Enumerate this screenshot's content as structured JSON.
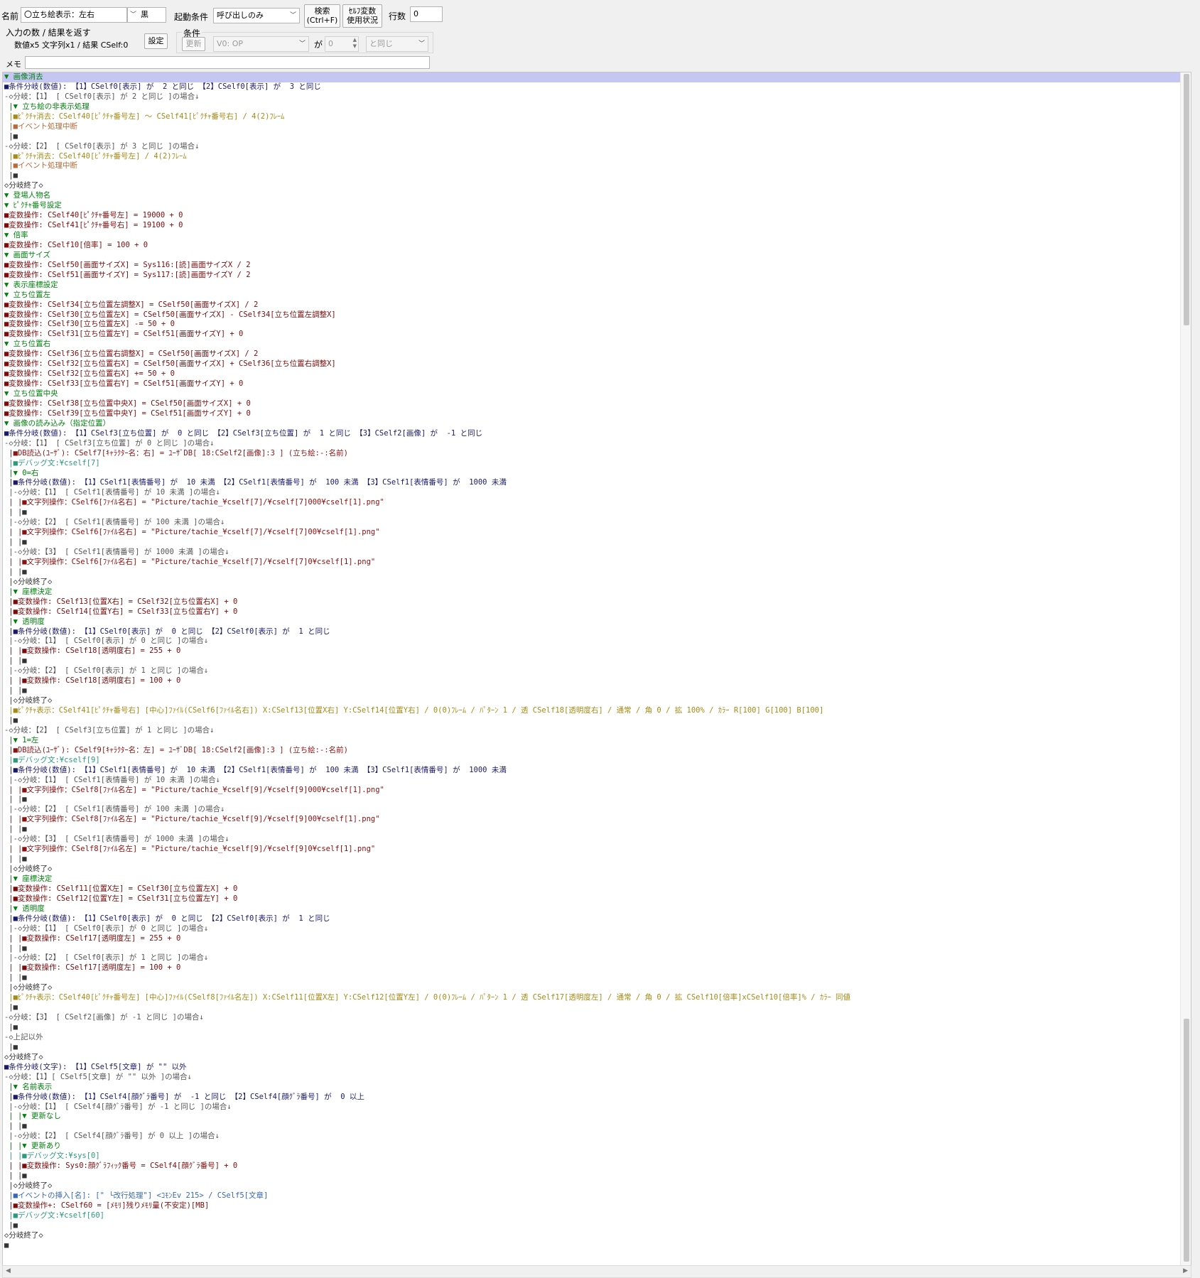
{
  "header": {
    "name_label": "名前",
    "name_value": "〇立ち絵表示：左右",
    "color_value": "黒",
    "trigger_label": "起動条件",
    "trigger_value": "呼び出しのみ",
    "search_label_1": "検索",
    "search_label_2": "(Ctrl+F)",
    "selfvar_label_1": "ｾﾙﾌ変数",
    "selfvar_label_2": "使用状況",
    "lines_label": "行数",
    "lines_value": "0",
    "io_label": "入力の数 / 結果を返す",
    "io_value": "数値x5 文字列x1 / 結果 CSelf:0",
    "setting_button": "設定",
    "cond_label": "条件",
    "update_button": "更新",
    "cond_var": "V0: OP",
    "ga": "が",
    "cond_num": "0",
    "cond_op": "と同じ",
    "memo_label": "メモ",
    "memo_value": ""
  },
  "code": {
    "lines": [
      {
        "t": "▼ 画像消去",
        "c": "c-header",
        "s": true
      },
      {
        "t": "■条件分岐(数値): 【1】CSelf0[表示] が  2 と同じ 【2】CSelf0[表示] が  3 と同じ",
        "c": "c-cond"
      },
      {
        "t": "-◇分岐：【1】 [ CSelf0[表示] が 2 と同じ ]の場合↓",
        "c": "c-branch"
      },
      {
        "t": " |▼ 立ち絵の非表示処理",
        "c": "c-sub"
      },
      {
        "t": " |■ﾋﾟｸﾁｬ消去：CSelf40[ﾋﾟｸﾁｬ番号左] ～ CSelf41[ﾋﾟｸﾁｬ番号右] / 4(2)ﾌﾚｰﾑ",
        "c": "c-pic"
      },
      {
        "t": " |■イベント処理中断",
        "c": "c-ev"
      },
      {
        "t": " |■",
        "c": "c-blank"
      },
      {
        "t": "-◇分岐：【2】 [ CSelf0[表示] が 3 と同じ ]の場合↓",
        "c": "c-branch"
      },
      {
        "t": " |■ﾋﾟｸﾁｬ消去：CSelf40[ﾋﾟｸﾁｬ番号左] / 4(2)ﾌﾚｰﾑ",
        "c": "c-pic"
      },
      {
        "t": " |■イベント処理中断",
        "c": "c-ev"
      },
      {
        "t": " |■",
        "c": "c-blank"
      },
      {
        "t": "◇分岐終了◇",
        "c": "c-end"
      },
      {
        "t": "▼ 登場人物名",
        "c": "c-header"
      },
      {
        "t": "▼ ﾋﾟｸﾁｬ番号設定",
        "c": "c-header"
      },
      {
        "t": "■変数操作: CSelf40[ﾋﾟｸﾁｬ番号左] = 19000 + 0",
        "c": "c-var"
      },
      {
        "t": "■変数操作: CSelf41[ﾋﾟｸﾁｬ番号右] = 19100 + 0",
        "c": "c-var"
      },
      {
        "t": "▼ 倍率",
        "c": "c-header"
      },
      {
        "t": "■変数操作: CSelf10[倍率] = 100 + 0",
        "c": "c-var"
      },
      {
        "t": "▼ 画面サイズ",
        "c": "c-header"
      },
      {
        "t": "■変数操作: CSelf50[画面サイズX] = Sys116:[読]画面サイズX / 2",
        "c": "c-var"
      },
      {
        "t": "■変数操作: CSelf51[画面サイズY] = Sys117:[読]画面サイズY / 2",
        "c": "c-var"
      },
      {
        "t": "▼ 表示座標設定",
        "c": "c-header"
      },
      {
        "t": "▼ 立ち位置左",
        "c": "c-header"
      },
      {
        "t": "■変数操作: CSelf34[立ち位置左調整X] = CSelf50[画面サイズX] / 2",
        "c": "c-var"
      },
      {
        "t": "■変数操作: CSelf30[立ち位置左X] = CSelf50[画面サイズX] - CSelf34[立ち位置左調整X]",
        "c": "c-var"
      },
      {
        "t": "■変数操作: CSelf30[立ち位置左X] -= 50 + 0",
        "c": "c-var"
      },
      {
        "t": "■変数操作: CSelf31[立ち位置左Y] = CSelf51[画面サイズY] + 0",
        "c": "c-var"
      },
      {
        "t": "▼ 立ち位置右",
        "c": "c-header"
      },
      {
        "t": "■変数操作: CSelf36[立ち位置右調整X] = CSelf50[画面サイズX] / 2",
        "c": "c-var"
      },
      {
        "t": "■変数操作: CSelf32[立ち位置右X] = CSelf50[画面サイズX] + CSelf36[立ち位置右調整X]",
        "c": "c-var"
      },
      {
        "t": "■変数操作: CSelf32[立ち位置右X] += 50 + 0",
        "c": "c-var"
      },
      {
        "t": "■変数操作: CSelf33[立ち位置右Y] = CSelf51[画面サイズY] + 0",
        "c": "c-var"
      },
      {
        "t": "▼ 立ち位置中央",
        "c": "c-header"
      },
      {
        "t": "■変数操作: CSelf38[立ち位置中央X] = CSelf50[画面サイズX] + 0",
        "c": "c-var"
      },
      {
        "t": "■変数操作: CSelf39[立ち位置中央Y] = CSelf51[画面サイズY] + 0",
        "c": "c-var"
      },
      {
        "t": "▼ 画像の読み込み（指定位置）",
        "c": "c-header"
      },
      {
        "t": "■条件分岐(数値): 【1】CSelf3[立ち位置] が  0 と同じ 【2】CSelf3[立ち位置] が  1 と同じ 【3】CSelf2[画像] が  -1 と同じ",
        "c": "c-cond"
      },
      {
        "t": "-◇分岐：【1】 [ CSelf3[立ち位置] が 0 と同じ ]の場合↓",
        "c": "c-branch"
      },
      {
        "t": " |■DB読込(ﾕｰｻﾞ): CSelf7[ｷｬﾗｸﾀｰ名：右] = ﾕｰｻﾞDB[ 18:CSelf2[画像]:3 ] (立ち絵:-:名前)",
        "c": "c-db"
      },
      {
        "t": " |■デバッグ文:¥cself[7]",
        "c": "c-debug"
      },
      {
        "t": " |▼ 0=右",
        "c": "c-sub"
      },
      {
        "t": " |■条件分岐(数値): 【1】CSelf1[表情番号] が  10 未満 【2】CSelf1[表情番号] が  100 未満 【3】CSelf1[表情番号] が  1000 未満",
        "c": "c-cond"
      },
      {
        "t": " |-◇分岐：【1】 [ CSelf1[表情番号] が 10 未満 ]の場合↓",
        "c": "c-branch"
      },
      {
        "t": " | |■文字列操作：CSelf6[ﾌｧｲﾙ名右] = \"Picture/tachie_¥cself[7]/¥cself[7]000¥cself[1].png\"",
        "c": "c-str"
      },
      {
        "t": " | |■",
        "c": "c-blank"
      },
      {
        "t": " |-◇分岐：【2】 [ CSelf1[表情番号] が 100 未満 ]の場合↓",
        "c": "c-branch"
      },
      {
        "t": " | |■文字列操作：CSelf6[ﾌｧｲﾙ名右] = \"Picture/tachie_¥cself[7]/¥cself[7]00¥cself[1].png\"",
        "c": "c-str"
      },
      {
        "t": " | |■",
        "c": "c-blank"
      },
      {
        "t": " |-◇分岐：【3】 [ CSelf1[表情番号] が 1000 未満 ]の場合↓",
        "c": "c-branch"
      },
      {
        "t": " | |■文字列操作：CSelf6[ﾌｧｲﾙ名右] = \"Picture/tachie_¥cself[7]/¥cself[7]0¥cself[1].png\"",
        "c": "c-str"
      },
      {
        "t": " | |■",
        "c": "c-blank"
      },
      {
        "t": " |◇分岐終了◇",
        "c": "c-end"
      },
      {
        "t": " |▼ 座標決定",
        "c": "c-sub"
      },
      {
        "t": " |■変数操作: CSelf13[位置X右] = CSelf32[立ち位置右X] + 0",
        "c": "c-var"
      },
      {
        "t": " |■変数操作: CSelf14[位置Y右] = CSelf33[立ち位置右Y] + 0",
        "c": "c-var"
      },
      {
        "t": " |▼ 透明度",
        "c": "c-sub"
      },
      {
        "t": " |■条件分岐(数値): 【1】CSelf0[表示] が  0 と同じ 【2】CSelf0[表示] が  1 と同じ",
        "c": "c-cond"
      },
      {
        "t": " |-◇分岐：【1】 [ CSelf0[表示] が 0 と同じ ]の場合↓",
        "c": "c-branch"
      },
      {
        "t": " | |■変数操作: CSelf18[透明度右] = 255 + 0",
        "c": "c-var"
      },
      {
        "t": " | |■",
        "c": "c-blank"
      },
      {
        "t": " |-◇分岐：【2】 [ CSelf0[表示] が 1 と同じ ]の場合↓",
        "c": "c-branch"
      },
      {
        "t": " | |■変数操作: CSelf18[透明度右] = 100 + 0",
        "c": "c-var"
      },
      {
        "t": " | |■",
        "c": "c-blank"
      },
      {
        "t": " |◇分岐終了◇",
        "c": "c-end"
      },
      {
        "t": " |■ﾋﾟｸﾁｬ表示：CSelf41[ﾋﾟｸﾁｬ番号右] [中心]ﾌｧｲﾙ(CSelf6[ﾌｧｲﾙ名右]) X:CSelf13[位置X右] Y:CSelf14[位置Y右] / 0(0)ﾌﾚｰﾑ / ﾊﾟﾀｰﾝ 1 / 透 CSelf18[透明度右] / 通常 / 角 0 / 拡 100% / ｶﾗｰ R[100] G[100] B[100]",
        "c": "c-pic"
      },
      {
        "t": " |■",
        "c": "c-blank"
      },
      {
        "t": "-◇分岐：【2】 [ CSelf3[立ち位置] が 1 と同じ ]の場合↓",
        "c": "c-branch"
      },
      {
        "t": " |▼ 1=左",
        "c": "c-sub"
      },
      {
        "t": " |■DB読込(ﾕｰｻﾞ): CSelf9[ｷｬﾗｸﾀｰ名：左] = ﾕｰｻﾞDB[ 18:CSelf2[画像]:3 ] (立ち絵:-:名前)",
        "c": "c-db"
      },
      {
        "t": " |■デバッグ文:¥cself[9]",
        "c": "c-debug"
      },
      {
        "t": " |■条件分岐(数値): 【1】CSelf1[表情番号] が  10 未満 【2】CSelf1[表情番号] が  100 未満 【3】CSelf1[表情番号] が  1000 未満",
        "c": "c-cond"
      },
      {
        "t": " |-◇分岐：【1】 [ CSelf1[表情番号] が 10 未満 ]の場合↓",
        "c": "c-branch"
      },
      {
        "t": " | |■文字列操作：CSelf8[ﾌｧｲﾙ名左] = \"Picture/tachie_¥cself[9]/¥cself[9]000¥cself[1].png\"",
        "c": "c-str"
      },
      {
        "t": " | |■",
        "c": "c-blank"
      },
      {
        "t": " |-◇分岐：【2】 [ CSelf1[表情番号] が 100 未満 ]の場合↓",
        "c": "c-branch"
      },
      {
        "t": " | |■文字列操作：CSelf8[ﾌｧｲﾙ名左] = \"Picture/tachie_¥cself[9]/¥cself[9]00¥cself[1].png\"",
        "c": "c-str"
      },
      {
        "t": " | |■",
        "c": "c-blank"
      },
      {
        "t": " |-◇分岐：【3】 [ CSelf1[表情番号] が 1000 未満 ]の場合↓",
        "c": "c-branch"
      },
      {
        "t": " | |■文字列操作：CSelf8[ﾌｧｲﾙ名左] = \"Picture/tachie_¥cself[9]/¥cself[9]0¥cself[1].png\"",
        "c": "c-str"
      },
      {
        "t": " | |■",
        "c": "c-blank"
      },
      {
        "t": " |◇分岐終了◇",
        "c": "c-end"
      },
      {
        "t": " |▼ 座標決定",
        "c": "c-sub"
      },
      {
        "t": " |■変数操作: CSelf11[位置X左] = CSelf30[立ち位置左X] + 0",
        "c": "c-var"
      },
      {
        "t": " |■変数操作: CSelf12[位置Y左] = CSelf31[立ち位置左Y] + 0",
        "c": "c-var"
      },
      {
        "t": " |▼ 透明度",
        "c": "c-sub"
      },
      {
        "t": " |■条件分岐(数値): 【1】CSelf0[表示] が  0 と同じ 【2】CSelf0[表示] が  1 と同じ",
        "c": "c-cond"
      },
      {
        "t": " |-◇分岐：【1】 [ CSelf0[表示] が 0 と同じ ]の場合↓",
        "c": "c-branch"
      },
      {
        "t": " | |■変数操作: CSelf17[透明度左] = 255 + 0",
        "c": "c-var"
      },
      {
        "t": " | |■",
        "c": "c-blank"
      },
      {
        "t": " |-◇分岐：【2】 [ CSelf0[表示] が 1 と同じ ]の場合↓",
        "c": "c-branch"
      },
      {
        "t": " | |■変数操作: CSelf17[透明度左] = 100 + 0",
        "c": "c-var"
      },
      {
        "t": " | |■",
        "c": "c-blank"
      },
      {
        "t": " |◇分岐終了◇",
        "c": "c-end"
      },
      {
        "t": " |■ﾋﾟｸﾁｬ表示：CSelf40[ﾋﾟｸﾁｬ番号左] [中心]ﾌｧｲﾙ(CSelf8[ﾌｧｲﾙ名左]) X:CSelf11[位置X左] Y:CSelf12[位置Y左] / 0(0)ﾌﾚｰﾑ / ﾊﾟﾀｰﾝ 1 / 透 CSelf17[透明度左] / 通常 / 角 0 / 拡 CSelf10[倍率]xCSelf10[倍率]% / ｶﾗｰ 同値",
        "c": "c-pic"
      },
      {
        "t": " |■",
        "c": "c-blank"
      },
      {
        "t": "-◇分岐：【3】 [ CSelf2[画像] が -1 と同じ ]の場合↓",
        "c": "c-branch"
      },
      {
        "t": " |■",
        "c": "c-blank"
      },
      {
        "t": "-◇上記以外",
        "c": "c-branch"
      },
      {
        "t": " |■",
        "c": "c-blank"
      },
      {
        "t": "◇分岐終了◇",
        "c": "c-end"
      },
      {
        "t": "■条件分岐(文字): 【1】CSelf5[文章] が \"\" 以外",
        "c": "c-cond"
      },
      {
        "t": "-◇分岐：【1】[ CSelf5[文章] が \"\" 以外 ]の場合↓",
        "c": "c-branch"
      },
      {
        "t": " |▼ 名前表示",
        "c": "c-sub"
      },
      {
        "t": " |■条件分岐(数値): 【1】CSelf4[顔ｸﾞﾗ番号] が  -1 と同じ 【2】CSelf4[顔ｸﾞﾗ番号] が  0 以上",
        "c": "c-cond"
      },
      {
        "t": " |-◇分岐：【1】 [ CSelf4[顔ｸﾞﾗ番号] が -1 と同じ ]の場合↓",
        "c": "c-branch"
      },
      {
        "t": " | |▼ 更新なし",
        "c": "c-sub"
      },
      {
        "t": " | |■",
        "c": "c-blank"
      },
      {
        "t": " |-◇分岐：【2】 [ CSelf4[顔ｸﾞﾗ番号] が 0 以上 ]の場合↓",
        "c": "c-branch"
      },
      {
        "t": " | |▼ 更新あり",
        "c": "c-sub"
      },
      {
        "t": " | |■デバッグ文:¥sys[0]",
        "c": "c-debug"
      },
      {
        "t": " | |■変数操作: Sys0:顔ｸﾞﾗﾌｨｯｸ番号 = CSelf4[顔ｸﾞﾗ番号] + 0",
        "c": "c-var"
      },
      {
        "t": " | |■",
        "c": "c-blank"
      },
      {
        "t": " |◇分岐終了◇",
        "c": "c-end"
      },
      {
        "t": " |■イベントの挿入[名]: [\" └改行処理\"] <ｺﾓﾝEv 215> / CSelf5[文章]",
        "c": "c-call"
      },
      {
        "t": " |■変数操作+: CSelf60 = [ﾒﾓﾘ]残りﾒﾓﾘ量(不安定)[MB]",
        "c": "c-var"
      },
      {
        "t": " |■デバッグ文:¥cself[60]",
        "c": "c-debug"
      },
      {
        "t": " |■",
        "c": "c-blank"
      },
      {
        "t": "◇分岐終了◇",
        "c": "c-end"
      },
      {
        "t": "■",
        "c": "c-blank"
      }
    ]
  }
}
